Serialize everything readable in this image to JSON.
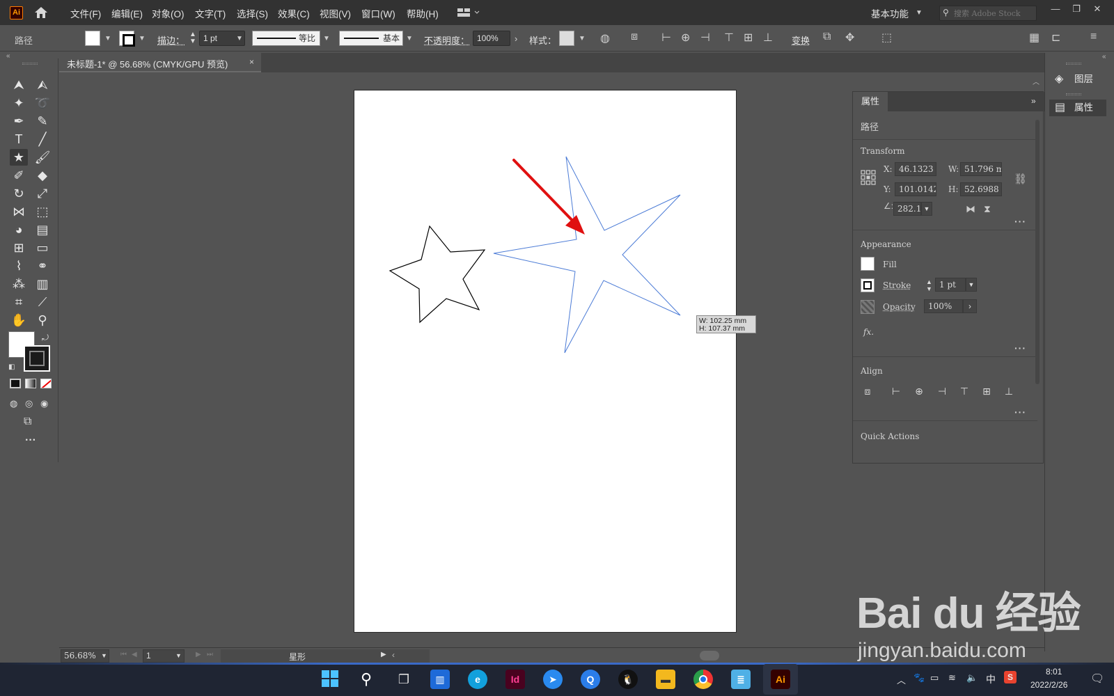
{
  "menubar": {
    "app_logo": "Ai",
    "items": [
      "文件(F)",
      "编辑(E)",
      "对象(O)",
      "文字(T)",
      "选择(S)",
      "效果(C)",
      "视图(V)",
      "窗口(W)",
      "帮助(H)"
    ],
    "workspace": "基本功能",
    "search_placeholder": "搜索 Adobe Stock"
  },
  "controlbar": {
    "object_type": "路径",
    "stroke_label": "描边：",
    "stroke_weight": "1 pt",
    "profile_uniform": "等比",
    "brush_basic": "基本",
    "opacity_label": "不透明度：",
    "opacity_value": "100%",
    "style_label": "样式：",
    "transform_label": "变换"
  },
  "document_tab": {
    "title": "未标题-1* @ 56.68% (CMYK/GPU 预览)",
    "close": "×"
  },
  "tooltip": {
    "width": "W: 102.25 mm",
    "height": "H: 107.37 mm"
  },
  "properties_panel": {
    "tab": "属性",
    "object_type": "路径",
    "transform_title": "Transform",
    "x_label": "X:",
    "x_value": "46.1323",
    "y_label": "Y:",
    "y_value": "101.0142",
    "w_label": "W:",
    "w_value": "51.796 m",
    "h_label": "H:",
    "h_value": "52.6988",
    "angle_value": "282.1",
    "appearance_title": "Appearance",
    "fill_label": "Fill",
    "stroke_label": "Stroke",
    "stroke_value": "1 pt",
    "opacity_label": "Opacity",
    "opacity_value": "100%",
    "fx_label": "fx.",
    "align_title": "Align",
    "quick_actions_title": "Quick Actions"
  },
  "side_panel": {
    "layers": "图层",
    "properties": "属性"
  },
  "statusbar": {
    "zoom": "56.68%",
    "artboard_num": "1",
    "tool_name": "星形"
  },
  "taskbar": {
    "time": "8:01",
    "date": "2022/2/26",
    "ime": "中"
  },
  "watermark": {
    "brand": "Bai du 经验",
    "url": "jingyan.baidu.com"
  },
  "colors": {
    "ui_dark": "#323232",
    "ui_mid": "#535353",
    "selection_blue": "#4b7bd6",
    "arrow_red": "#e01010"
  }
}
